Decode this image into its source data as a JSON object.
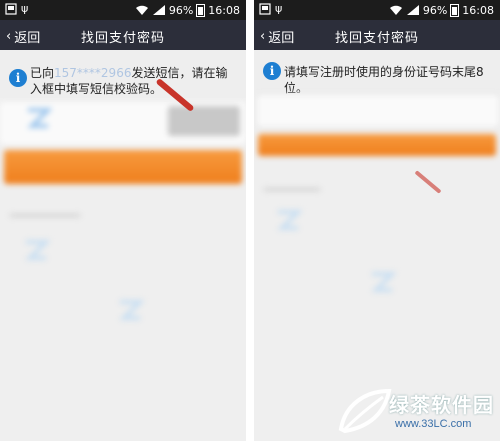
{
  "status_bar": {
    "battery": "96%",
    "time": "16:08"
  },
  "screens": [
    {
      "back_label": "返回",
      "title": "找回支付密码",
      "note_prefix": "已向",
      "note_masked": "157****2966",
      "note_suffix": "发送短信，请在输入框中填写短信校验码。"
    },
    {
      "back_label": "返回",
      "title": "找回支付密码",
      "note_text": "请填写注册时使用的身份证号码末尾8位。"
    }
  ],
  "watermark": {
    "brand": "绿茶软件园",
    "url": "www.33LC.com"
  },
  "colors": {
    "navbar": "#2c2e3a",
    "status_bar": "#1c1c1c",
    "info": "#1e7fd2",
    "orange": "#ef7f1d",
    "arrow": "#c8342a"
  }
}
